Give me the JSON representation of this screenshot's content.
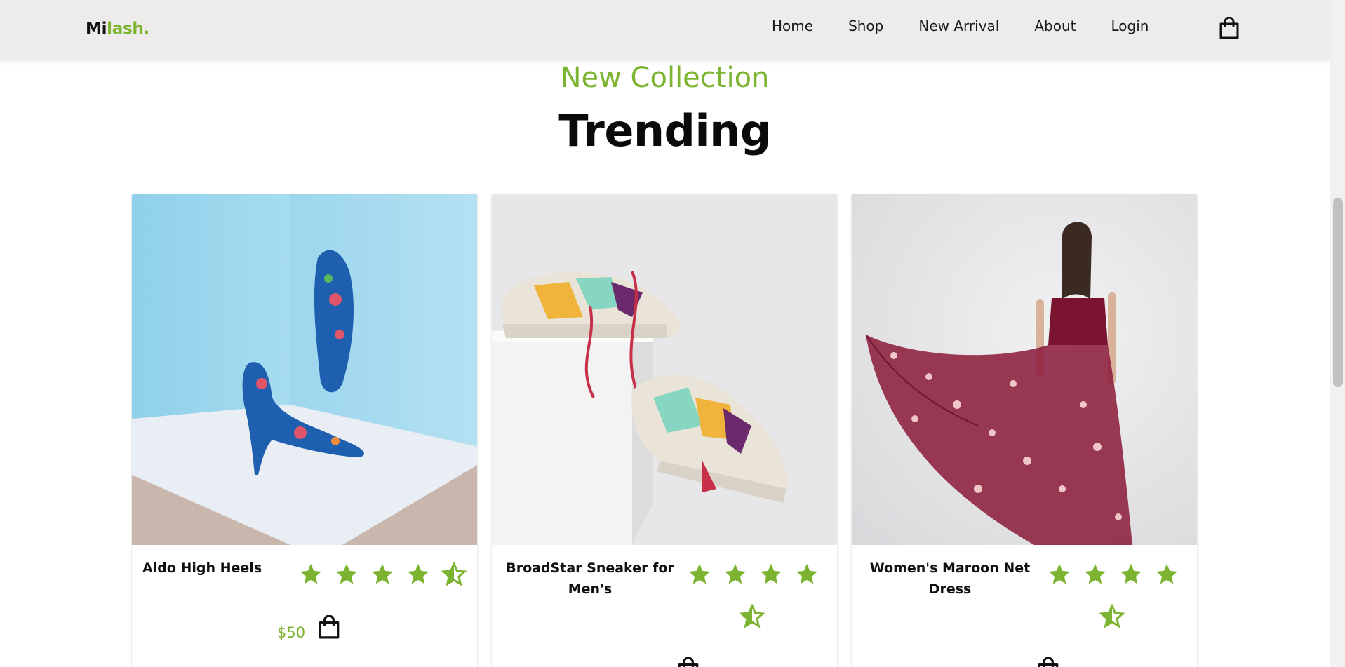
{
  "brand": {
    "logo_main": "Mi",
    "logo_accent": "lash."
  },
  "nav": {
    "items": [
      "Home",
      "Shop",
      "New Arrival",
      "About",
      "Login"
    ]
  },
  "section": {
    "subtitle": "New Collection",
    "title": "Trending"
  },
  "products": [
    {
      "name": "Aldo High Heels",
      "price": "$50",
      "rating": 4.5
    },
    {
      "name": "BroadStar Sneaker for Men's",
      "price": "",
      "rating": 4.5
    },
    {
      "name": "Women's Maroon Net Dress",
      "price": "",
      "rating": 4.5
    }
  ],
  "colors": {
    "accent": "#7cb431",
    "header_bg": "#eeeceb",
    "text": "#111111"
  },
  "icons": {
    "cart": "shopping-bag-icon",
    "star": "star-icon",
    "half_star": "half-star-icon",
    "add_to_cart": "shopping-bag-icon"
  }
}
